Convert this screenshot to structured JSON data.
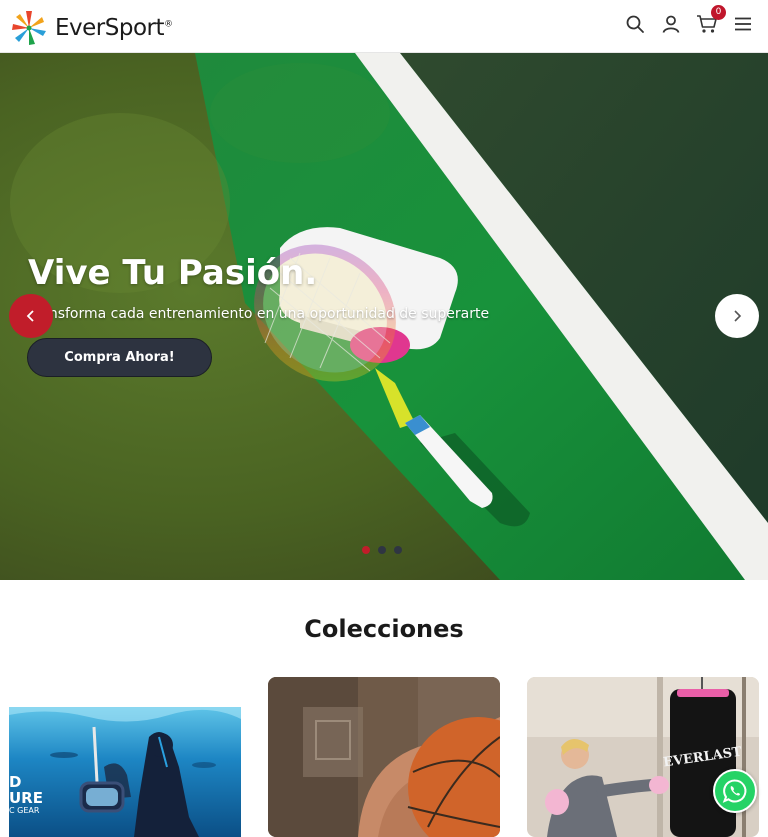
{
  "header": {
    "brand": "EverSport",
    "brand_mark": "®",
    "icons": [
      "search-icon",
      "user-icon",
      "cart-icon",
      "menu-icon"
    ],
    "cart_count": "0"
  },
  "hero": {
    "title": "Vive Tu Pasión.",
    "subtitle": "Transforma cada entrenamiento en una oportunidad de superarte",
    "button_label": "Compra Ahora!",
    "slides_total": 3,
    "active_slide": 1,
    "accent_color": "#c11d2a"
  },
  "collections": {
    "title": "Colecciones",
    "cards": [
      {
        "name": "diving",
        "caption_line1": "D",
        "caption_line2": "URE",
        "caption_line3": "C GEAR"
      },
      {
        "name": "basketball"
      },
      {
        "name": "boxing",
        "bag_brand": "EVERLAST"
      }
    ]
  },
  "whatsapp": {
    "icon": "whatsapp-icon",
    "color": "#25d366"
  }
}
